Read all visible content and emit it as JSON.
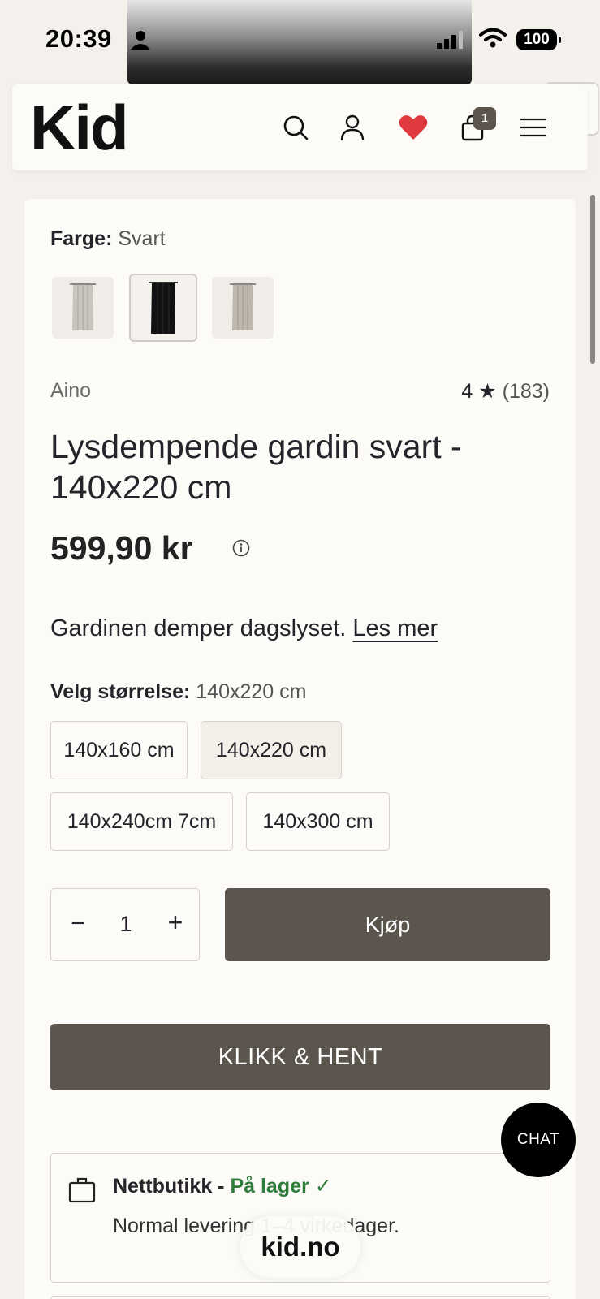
{
  "status_bar": {
    "time": "20:39",
    "battery": "100"
  },
  "header": {
    "logo": "Kid",
    "cart_count": "1",
    "icons": [
      "search-icon",
      "account-icon",
      "heart-icon",
      "cart-icon",
      "menu-icon"
    ],
    "heart_color": "#e03a3e"
  },
  "product": {
    "color_label": "Farge:",
    "color_value": "Svart",
    "swatches": [
      {
        "name": "light-grey",
        "color": "#c9c5bd"
      },
      {
        "name": "black",
        "color": "#111111",
        "selected": true
      },
      {
        "name": "beige",
        "color": "#bfb6ad"
      }
    ],
    "brand": "Aino",
    "rating": "4",
    "rating_count": "(183)",
    "title": "Lysdempende gardin svart - 140x220 cm",
    "price": "599,90 kr",
    "description": "Gardinen demper dagslyset.",
    "read_more": "Les mer",
    "size_label": "Velg størrelse:",
    "size_value": "140x220 cm",
    "sizes": [
      "140x160 cm",
      "140x220 cm",
      "140x240cm 7cm",
      "140x300 cm"
    ],
    "selected_size": "140x220 cm",
    "quantity": "1",
    "buy_label": "Kjøp",
    "click_collect_label": "KLIKK & HENT",
    "stock": {
      "store": "Nettbutikk -",
      "status": "På lager",
      "checkmark": "✓",
      "delivery": "Normal levering 1–4 virkedager."
    }
  },
  "chat_label": "CHAT",
  "url": "kid.no",
  "colors": {
    "button": "#5b554e",
    "in_stock": "#2f7d3b",
    "background": "#f4f1ec",
    "card": "#fcfbf8"
  }
}
